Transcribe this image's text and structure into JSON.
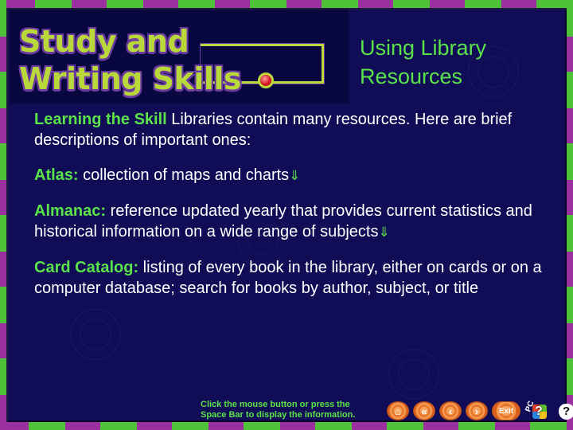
{
  "header": {
    "logo_line1": "Study and",
    "logo_line2": "Writing Skills",
    "title_line1": "Using Library",
    "title_line2": "Resources"
  },
  "content": {
    "intro": {
      "label": "Learning the Skill",
      "text": "  Libraries contain many resources.  Here are brief descriptions of important ones:"
    },
    "entries": [
      {
        "term": "Atlas:",
        "definition": "  collection of maps and charts",
        "arrow": "⇓"
      },
      {
        "term": "Almanac:",
        "definition": "  reference updated yearly that provides current statistics and historical information on a wide range of subjects",
        "arrow": "⇓"
      },
      {
        "term": "Card Catalog:",
        "definition": "  listing of every book in the library, either on cards or on a computer database; search for books by author, subject, or title",
        "arrow": ""
      }
    ]
  },
  "footer": {
    "instruction_line1": "Click the mouse button or press the",
    "instruction_line2": "Space Bar to display the information.",
    "nav": {
      "home": "⌂",
      "first": "«",
      "prev": "‹",
      "next": "›",
      "exit": "Exit",
      "pc_label": "PC",
      "help_q": "?",
      "mac_q": "?"
    }
  },
  "colors": {
    "background": "#100c55",
    "accent_green": "#5be34a",
    "logo_yellow": "#b9d83a",
    "border_purple": "#9a2fa0",
    "border_green": "#4fc23a",
    "button_orange": "#e6762a"
  }
}
